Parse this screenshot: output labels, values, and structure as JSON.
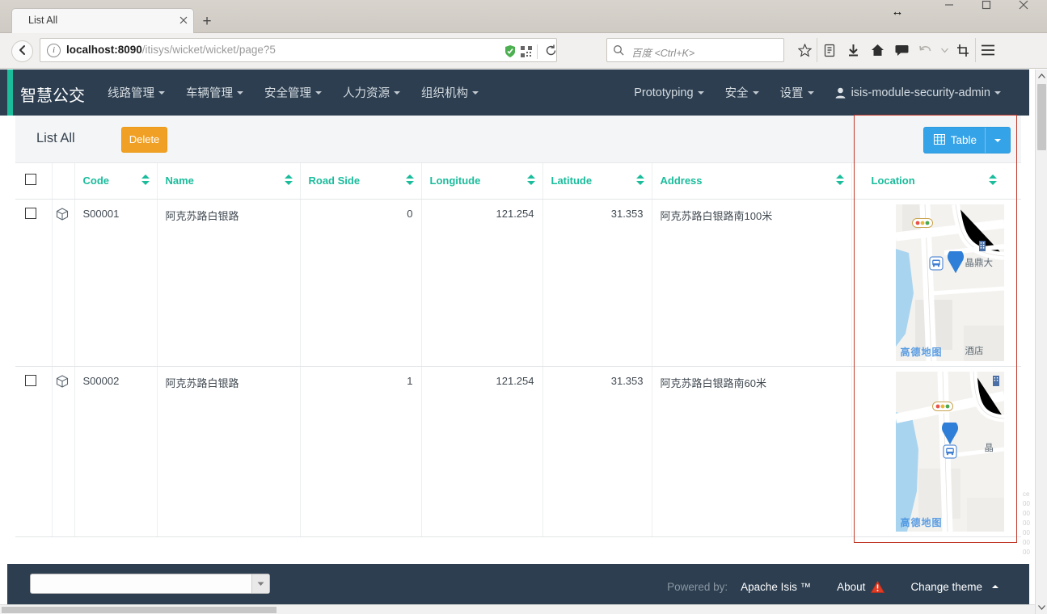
{
  "window": {
    "resize_icon": "resize-horizontal-icon",
    "minimize": "minimize-icon",
    "maximize": "maximize-icon",
    "close": "close-icon"
  },
  "browser": {
    "tab": {
      "title": "List All",
      "close_icon": "close-icon"
    },
    "new_tab_label": "+",
    "back_icon": "back-arrow-icon",
    "url": {
      "host": "localhost:8090",
      "path": "/itisys/wicket/wicket/page?5",
      "info_icon": "info-icon"
    },
    "url_icons": [
      "shield-icon",
      "qr-code-icon",
      "reload-icon"
    ],
    "search": {
      "placeholder": "百度 <Ctrl+K>",
      "icon": "search-icon"
    },
    "toolbar_icons": [
      "bookmark-star-icon",
      "library-icon",
      "downloads-icon",
      "home-icon",
      "chat-icon",
      "undo-icon",
      "chevron-down-icon",
      "screenshot-icon",
      "menu-icon"
    ]
  },
  "topnav": {
    "brand": "智慧公交",
    "left_items": [
      {
        "label": "线路管理",
        "caret": true
      },
      {
        "label": "车辆管理",
        "caret": true
      },
      {
        "label": "安全管理",
        "caret": true
      },
      {
        "label": "人力资源",
        "caret": true
      },
      {
        "label": "组织机构",
        "caret": true
      }
    ],
    "right_items": [
      {
        "label": "Prototyping",
        "caret": true
      },
      {
        "label": "安全",
        "caret": true
      },
      {
        "label": "设置",
        "caret": true
      },
      {
        "label": "isis-module-security-admin",
        "caret": true,
        "icon": "user-icon"
      }
    ]
  },
  "panel": {
    "title": "List All",
    "delete_label": "Delete",
    "view_button": {
      "label": "Table",
      "icon": "table-icon",
      "caret_icon": "caret-down-icon"
    }
  },
  "table": {
    "select_all_icon": "checkbox-icon",
    "columns": [
      {
        "key": "check",
        "label": "",
        "sortable": false,
        "align": "left"
      },
      {
        "key": "obj",
        "label": "",
        "sortable": false,
        "align": "left"
      },
      {
        "key": "code",
        "label": "Code",
        "sortable": true,
        "align": "left"
      },
      {
        "key": "name",
        "label": "Name",
        "sortable": true,
        "align": "left"
      },
      {
        "key": "roadside",
        "label": "Road Side",
        "sortable": true,
        "align": "right"
      },
      {
        "key": "lon",
        "label": "Longitude",
        "sortable": true,
        "align": "right"
      },
      {
        "key": "lat",
        "label": "Latitude",
        "sortable": true,
        "align": "right"
      },
      {
        "key": "address",
        "label": "Address",
        "sortable": true,
        "align": "left"
      },
      {
        "key": "location",
        "label": "Location",
        "sortable": true,
        "align": "left"
      }
    ],
    "rows": [
      {
        "code": "S00001",
        "name": "阿克苏路白银路",
        "roadside": "0",
        "lon": "121.254",
        "lat": "31.353",
        "address": "阿克苏路白银路南100米",
        "map": {
          "watermark": "高德地图",
          "labels": [
            "晶鼎大",
            "酒店"
          ],
          "markers": [
            "map-pin-icon",
            "bus-stop-icon",
            "traffic-light-icon",
            "building-icon"
          ]
        }
      },
      {
        "code": "S00002",
        "name": "阿克苏路白银路",
        "roadside": "1",
        "lon": "121.254",
        "lat": "31.353",
        "address": "阿克苏路白银路南60米",
        "map": {
          "watermark": "高德地图",
          "labels": [
            "晶"
          ],
          "markers": [
            "map-pin-icon",
            "bus-stop-icon",
            "traffic-light-icon"
          ]
        }
      }
    ]
  },
  "footer": {
    "select_value": "",
    "select_caret": "caret-down-icon",
    "powered_by": "Powered by:",
    "apache_isis": "Apache Isis ™",
    "about": "About",
    "about_icon": "warning-icon",
    "change_theme": "Change theme",
    "change_theme_caret": "caret-up-icon"
  },
  "colors": {
    "navbar": "#2c3e50",
    "accent_green": "#1abc9c",
    "delete_orange": "#f0a024",
    "table_blue": "#35a3e8",
    "highlight_red": "#c0392b"
  }
}
